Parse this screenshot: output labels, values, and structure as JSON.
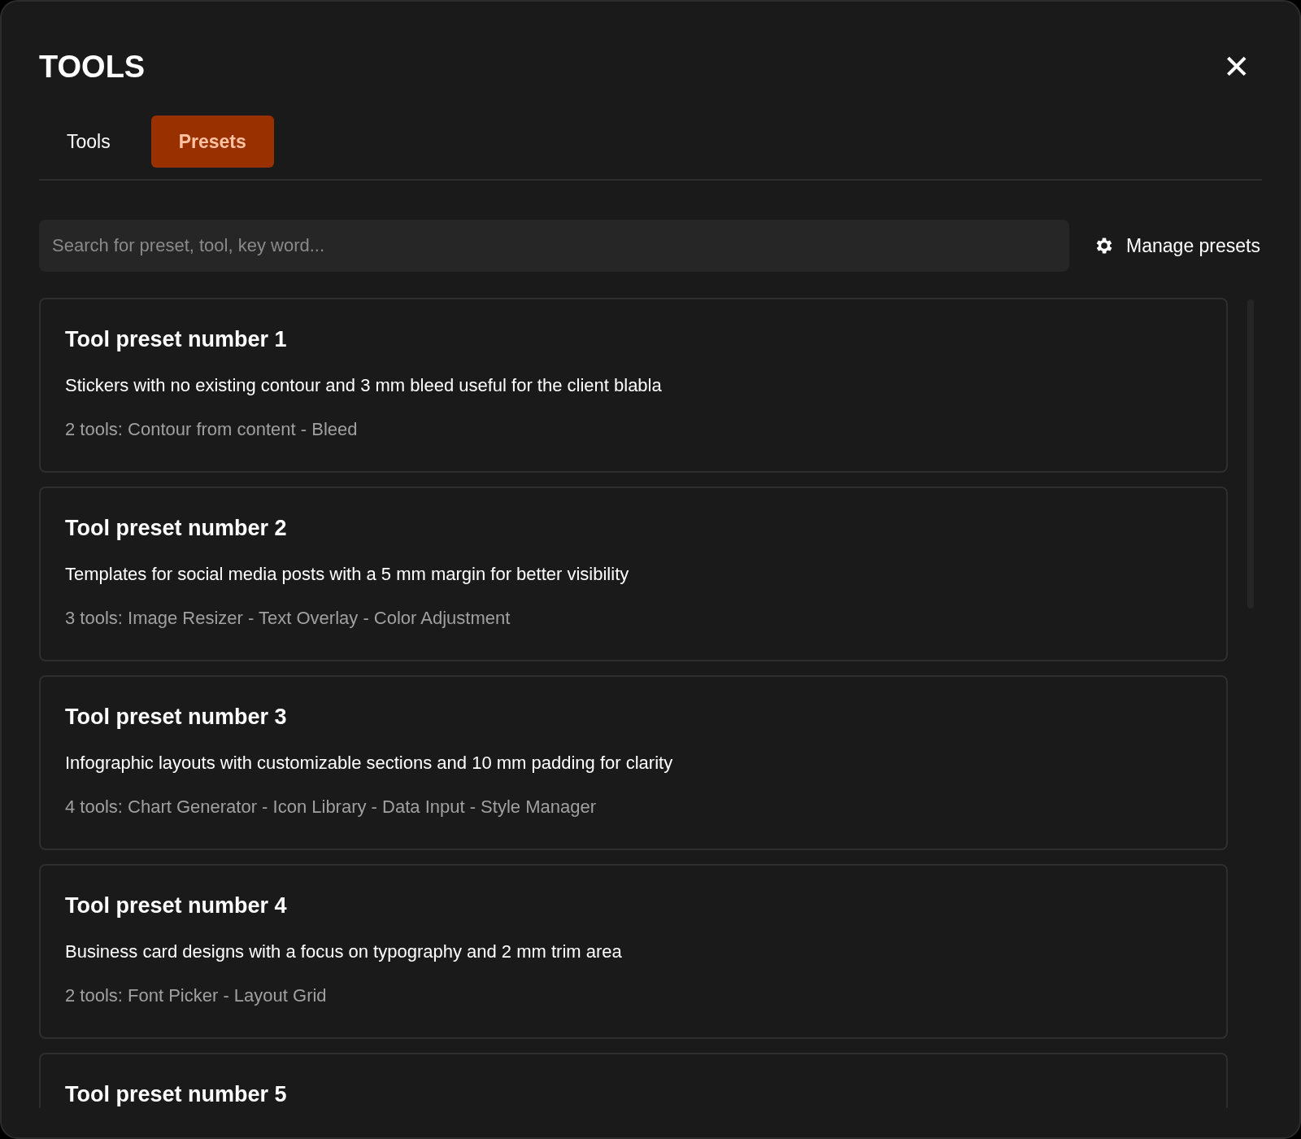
{
  "dialog": {
    "title": "TOOLS",
    "close_label": "✕"
  },
  "tabs": [
    {
      "label": "Tools",
      "selected": false
    },
    {
      "label": "Presets",
      "selected": true
    }
  ],
  "search": {
    "placeholder": "Search for preset, tool, key word..."
  },
  "manage_button": {
    "label": "Manage presets"
  },
  "presets": [
    {
      "title": "Tool preset number 1",
      "description": "Stickers with no existing contour and 3 mm bleed useful for the client blabla",
      "tools": "2 tools: Contour from content - Bleed"
    },
    {
      "title": "Tool preset number 2",
      "description": "Templates for social media posts with a 5 mm margin for better visibility",
      "tools": "3 tools: Image Resizer - Text Overlay - Color Adjustment"
    },
    {
      "title": "Tool preset number 3",
      "description": "Infographic layouts with customizable sections and 10 mm padding for clarity",
      "tools": "4 tools: Chart Generator - Icon Library - Data Input - Style Manager"
    },
    {
      "title": "Tool preset number 4",
      "description": "Business card designs with a focus on typography and 2 mm trim area",
      "tools": "2 tools: Font Picker - Layout Grid"
    },
    {
      "title": "Tool preset number 5"
    }
  ]
}
